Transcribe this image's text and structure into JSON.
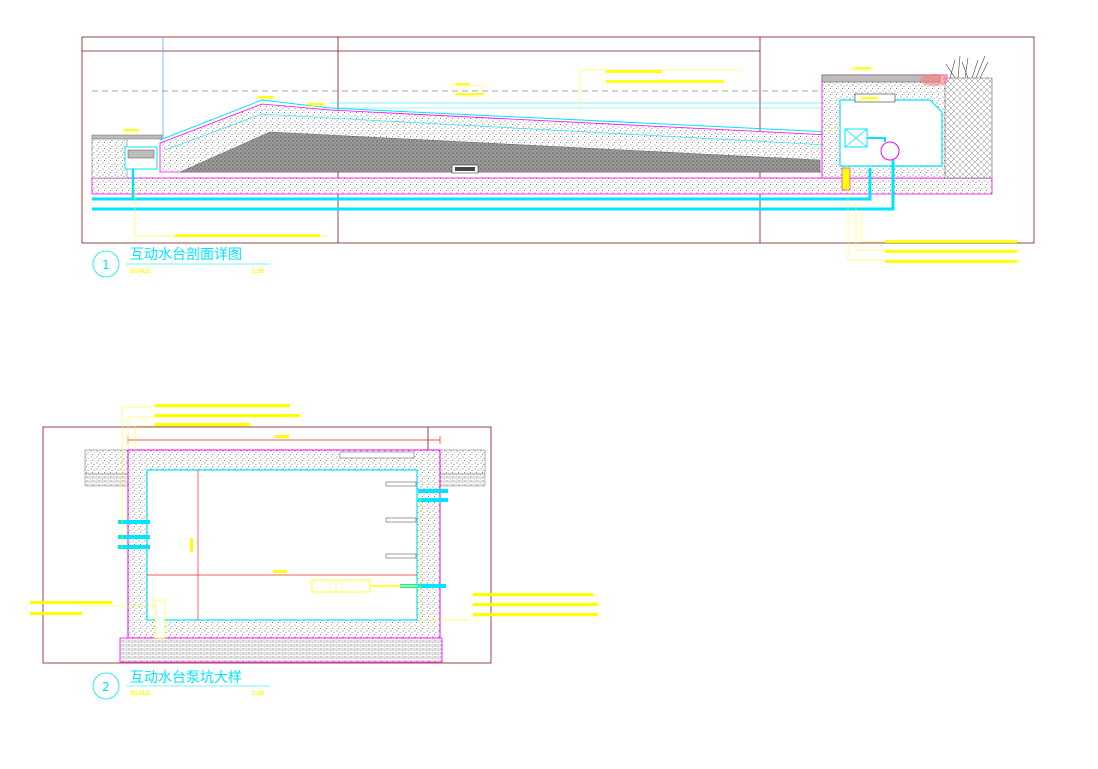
{
  "colors": {
    "frame": "#7a1a1a",
    "cyan": "#00e5ff",
    "magenta": "#ff00ff",
    "yellow": "#ffff00",
    "red": "#ff2222",
    "concrete": "#bdbdbd",
    "gray_line": "#8a8a8a"
  },
  "detail1": {
    "number": "1",
    "title": "互动水台剖面详图",
    "scale_label": "SCALE",
    "scale_value": "1:20"
  },
  "detail2": {
    "number": "2",
    "title": "互动水台泵坑大样",
    "scale_label": "SCALE",
    "scale_value": "1:20"
  }
}
